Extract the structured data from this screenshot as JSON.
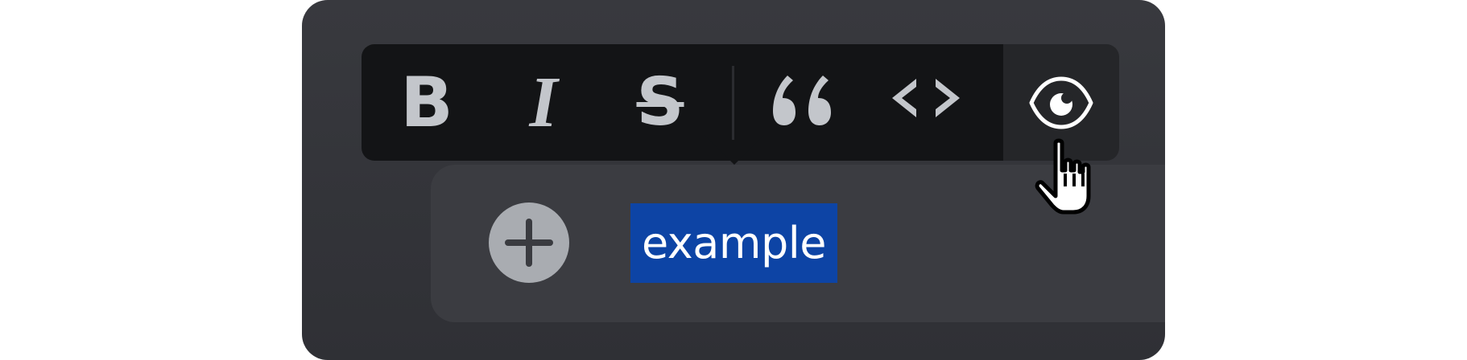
{
  "toolbar": {
    "bold": {
      "label": "B",
      "icon": "bold-icon"
    },
    "italic": {
      "label": "I",
      "icon": "italic-icon"
    },
    "strikethrough": {
      "label": "S",
      "icon": "strikethrough-icon"
    },
    "quote": {
      "icon": "quote-icon"
    },
    "code": {
      "icon": "code-icon"
    },
    "preview": {
      "icon": "eye-icon"
    }
  },
  "editor": {
    "selected_text": "example",
    "add_icon": "plus-icon"
  },
  "colors": {
    "frame_bg": "#34353a",
    "toolbar_bg": "#131416",
    "toolbar_active_bg": "#252629",
    "icon_color": "#c3c6cb",
    "selection_bg": "#0d44a5",
    "add_button_bg": "#a9acb1"
  },
  "cursor": {
    "icon": "hand-pointer-icon"
  }
}
